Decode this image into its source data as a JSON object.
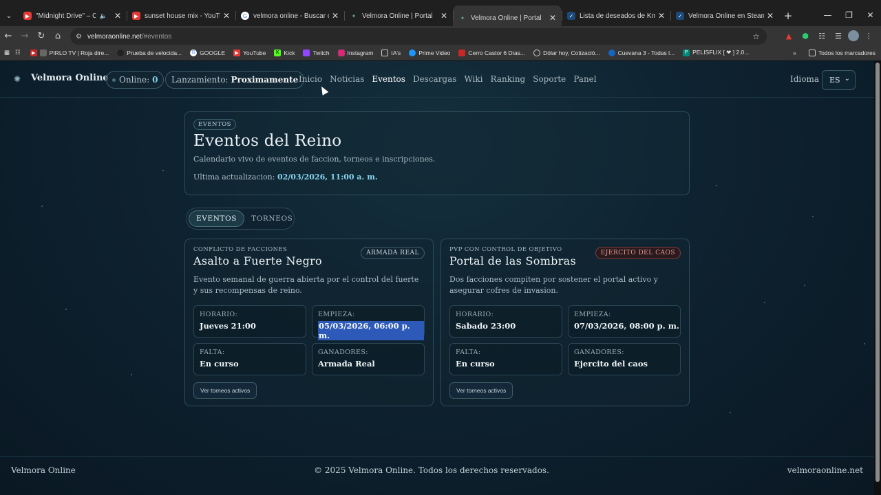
{
  "browser": {
    "tabs": [
      {
        "title": "\"Midnight Drive\" – Chill Ra",
        "favicon_color": "#e53935",
        "audio": true
      },
      {
        "title": "sunset house mix - YouTube",
        "favicon_color": "#e53935",
        "audio": false
      },
      {
        "title": "velmora online - Buscar con Go",
        "favicon_color": "#e0e0e0",
        "audio": false
      },
      {
        "title": "Velmora Online | Portal",
        "favicon_color": "#5a8a6a",
        "audio": false
      },
      {
        "title": "Velmora Online | Portal",
        "favicon_color": "#5a8a6a",
        "audio": false,
        "active": true
      },
      {
        "title": "Lista de deseados de Kmoney",
        "favicon_color": "#2a5a8a",
        "audio": false
      },
      {
        "title": "Velmora Online en Steam",
        "favicon_color": "#2a5a8a",
        "audio": false
      }
    ],
    "url_host": "velmoraonline.net",
    "url_path": "/#eventos",
    "bookmarks": [
      {
        "label": "PIRLO TV | Roja dire...",
        "color": "#c62828"
      },
      {
        "label": "Prueba de velocida...",
        "color": "#222"
      },
      {
        "label": "GOOGLE",
        "color": "#4285f4"
      },
      {
        "label": "YouTube",
        "color": "#e53935"
      },
      {
        "label": "Kick",
        "color": "#53fc18"
      },
      {
        "label": "Twitch",
        "color": "#9146ff"
      },
      {
        "label": "Instagram",
        "color": "#d62976"
      },
      {
        "label": "IA's",
        "color": "#555"
      },
      {
        "label": "Prime Video",
        "color": "#1a98ff"
      },
      {
        "label": "Cerro Castor 6 Días...",
        "color": "#c62828"
      },
      {
        "label": "Dólar hoy, Cotizació...",
        "color": "#555"
      },
      {
        "label": "Cuevana 3 - Todas l...",
        "color": "#1565c0"
      },
      {
        "label": "PELISFLIX [ ❤ ] 2.0...",
        "color": "#00897b"
      }
    ],
    "bookmarks_folder": "Todos los marcadores"
  },
  "site": {
    "brand": "Velmora Online",
    "online_label": "Online:",
    "online_count": "0",
    "launch_label": "Lanzamiento:",
    "launch_value": "Proximamente",
    "menu": [
      "Inicio",
      "Noticias",
      "Eventos",
      "Descargas",
      "Wiki",
      "Ranking",
      "Soporte",
      "Panel"
    ],
    "active_menu": "Eventos",
    "lang_label": "Idioma",
    "lang_value": "ES"
  },
  "hero": {
    "tag": "EVENTOS",
    "title": "Eventos del Reino",
    "subtitle": "Calendario vivo de eventos de faccion, torneos e inscripciones.",
    "updated_label": "Ultima actualizacion:",
    "updated_value": "02/03/2026, 11:00 a. m."
  },
  "tabs": [
    "EVENTOS",
    "TORNEOS"
  ],
  "events": [
    {
      "kicker": "CONFLICTO DE FACCIONES",
      "title": "Asalto a Fuerte Negro",
      "badge": "ARMADA REAL",
      "badge_color": "#c8d6db",
      "description": "Evento semanal de guerra abierta por el control del fuerte y sus recompensas de reino.",
      "schedule_label": "HORARIO:",
      "schedule": "Jueves 21:00",
      "start_label": "EMPIEZA:",
      "start": "05/03/2026, 06:00 p. m.",
      "remaining_label": "FALTA:",
      "remaining": "En curso",
      "winners_label": "GANADORES:",
      "winners": "Armada Real",
      "button": "Ver torneos activos"
    },
    {
      "kicker": "PVP CON CONTROL DE OBJETIVO",
      "title": "Portal de las Sombras",
      "badge": "EJERCITO DEL CAOS",
      "badge_color": "#e59a8e",
      "description": "Dos facciones compiten por sostener el portal activo y asegurar cofres de invasion.",
      "schedule_label": "HORARIO:",
      "schedule": "Sabado 23:00",
      "start_label": "EMPIEZA:",
      "start": "07/03/2026, 08:00 p. m.",
      "remaining_label": "FALTA:",
      "remaining": "En curso",
      "winners_label": "GANADORES:",
      "winners": "Ejercito del caos",
      "button": "Ver torneos activos"
    }
  ],
  "footer": {
    "left": "Velmora Online",
    "center": "© 2025 Velmora Online. Todos los derechos reservados.",
    "right": "velmoraonline.net"
  }
}
